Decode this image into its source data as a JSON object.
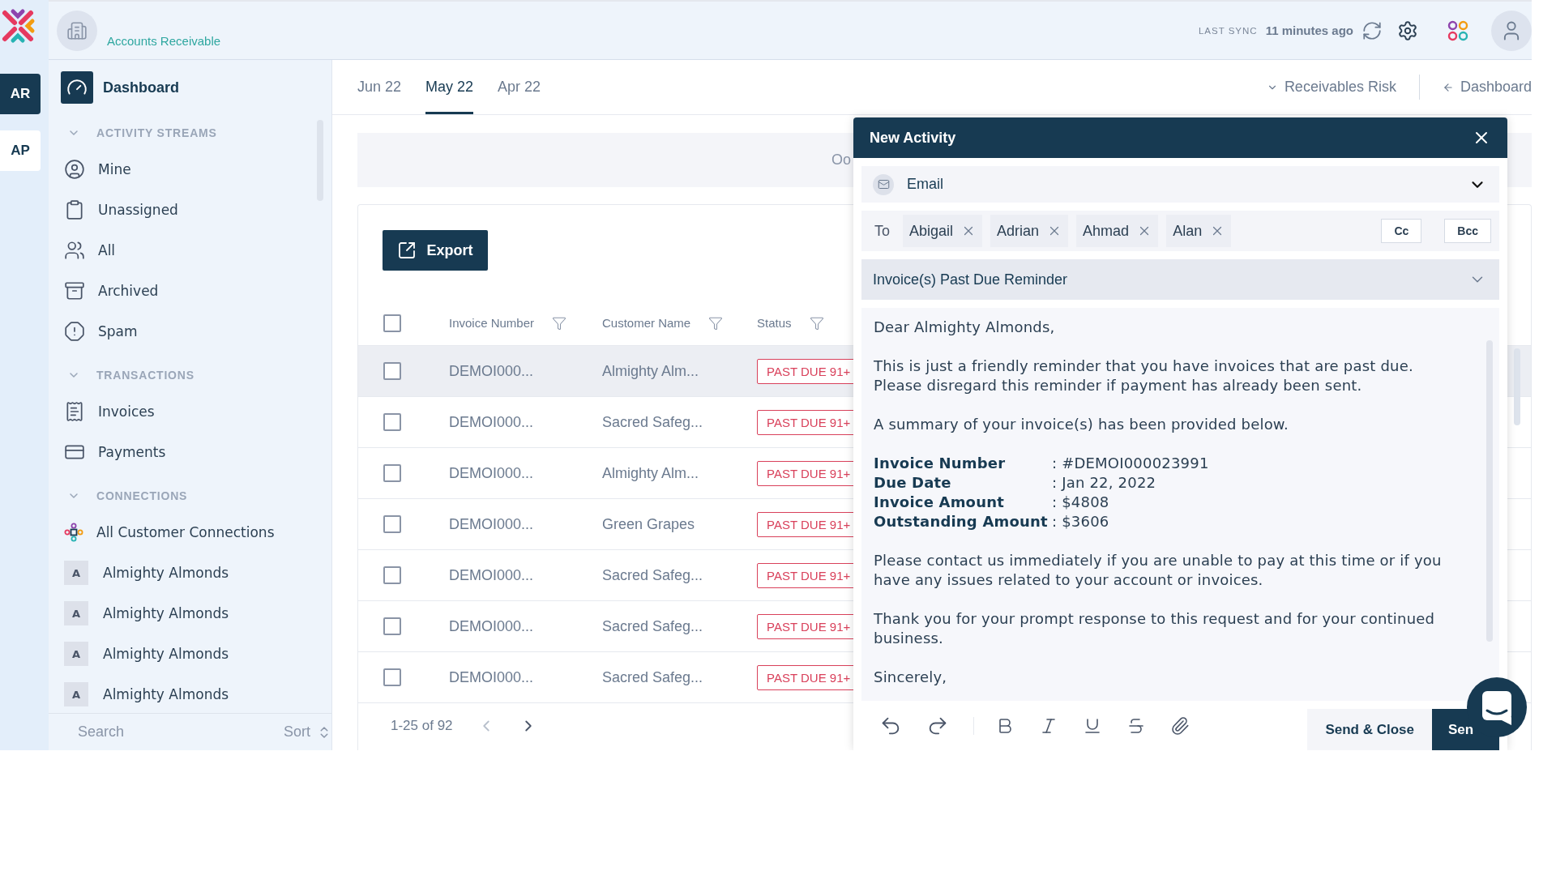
{
  "rail": {
    "items": [
      {
        "label": "AR",
        "selected": true
      },
      {
        "label": "AP",
        "selected": false
      }
    ]
  },
  "header": {
    "module": "Accounts Receivable",
    "sync_label": "LAST SYNC",
    "sync_time": "11 minutes ago"
  },
  "sidebar": {
    "dashboard": {
      "label": "Dashboard",
      "selected": true
    },
    "sections": [
      {
        "title": "ACTIVITY STREAMS",
        "expanded": true,
        "items": [
          {
            "label": "Mine",
            "kind": "user"
          },
          {
            "label": "Unassigned",
            "kind": "clipboard"
          },
          {
            "label": "All",
            "kind": "people"
          },
          {
            "label": "Archived",
            "kind": "archive"
          },
          {
            "label": "Spam",
            "kind": "alert"
          }
        ]
      },
      {
        "title": "TRANSACTIONS",
        "expanded": true,
        "items": [
          {
            "label": "Invoices",
            "kind": "invoice"
          },
          {
            "label": "Payments",
            "kind": "payment"
          }
        ]
      },
      {
        "title": "CONNECTIONS",
        "expanded": true,
        "items": [
          {
            "label": "All Customer Connections",
            "kind": "connections"
          },
          {
            "label": "Almighty Almonds",
            "kind": "letter",
            "letter": "A"
          },
          {
            "label": "Almighty Almonds",
            "kind": "letter",
            "letter": "A"
          },
          {
            "label": "Almighty Almonds",
            "kind": "letter",
            "letter": "A"
          },
          {
            "label": "Almighty Almonds",
            "kind": "letter",
            "letter": "A"
          }
        ]
      }
    ],
    "search": {
      "placeholder": "Search"
    },
    "sort": "Sort"
  },
  "tabs": [
    {
      "label": "Jun 22",
      "selected": false
    },
    {
      "label": "May 22",
      "selected": true
    },
    {
      "label": "Apr 22",
      "selected": false
    }
  ],
  "links": {
    "risk": "Receivables Risk",
    "back": "Dashboard"
  },
  "banner": "Oo",
  "table": {
    "export": "Export",
    "all_checked": false,
    "columns": [
      "Invoice Number",
      "Customer Name",
      "Status"
    ],
    "rows": [
      {
        "invoice": "DEMOI000...",
        "customer": "Almighty Alm...",
        "status": "PAST DUE 91+",
        "checked": false,
        "selected": true
      },
      {
        "invoice": "DEMOI000...",
        "customer": "Sacred Safeg...",
        "status": "PAST DUE 91+",
        "checked": false,
        "selected": false
      },
      {
        "invoice": "DEMOI000...",
        "customer": "Almighty Alm...",
        "status": "PAST DUE 91+",
        "checked": false,
        "selected": false
      },
      {
        "invoice": "DEMOI000...",
        "customer": "Green Grapes",
        "status": "PAST DUE 91+",
        "checked": false,
        "selected": false
      },
      {
        "invoice": "DEMOI000...",
        "customer": "Sacred Safeg...",
        "status": "PAST DUE 91+",
        "checked": false,
        "selected": false
      },
      {
        "invoice": "DEMOI000...",
        "customer": "Sacred Safeg...",
        "status": "PAST DUE 91+",
        "checked": false,
        "selected": false
      },
      {
        "invoice": "DEMOI000...",
        "customer": "Sacred Safeg...",
        "status": "PAST DUE 91+",
        "checked": false,
        "selected": false
      }
    ],
    "pagination": "1-25 of 92"
  },
  "modal": {
    "title": "New Activity",
    "channel": "Email",
    "to_label": "To",
    "recipients": [
      "Abigail",
      "Adrian",
      "Ahmad",
      "Alan"
    ],
    "cc": "Cc",
    "bcc": "Bcc",
    "template": "Invoice(s) Past Due Reminder",
    "body": [
      {
        "kind": "text",
        "lines": [
          "Dear Almighty Almonds,"
        ]
      },
      {
        "kind": "text",
        "lines": [
          "This is just a friendly reminder that you have invoices that are past due.",
          "Please disregard this reminder if payment has already been sent."
        ]
      },
      {
        "kind": "text",
        "lines": [
          "A summary of your invoice(s) has been provided below."
        ]
      },
      {
        "kind": "summary",
        "rows": [
          {
            "label": "Invoice Number",
            "value": ": #DEMOI000023991"
          },
          {
            "label": "Due Date",
            "value": ": Jan 22, 2022"
          },
          {
            "label": "Invoice Amount",
            "value": ": $4808"
          },
          {
            "label": "Outstanding Amount",
            "value": ": $3606"
          }
        ]
      },
      {
        "kind": "text",
        "lines": [
          "Please contact us immediately if you are unable to pay at this time or if you have any issues related to your account or invoices."
        ]
      },
      {
        "kind": "text",
        "lines": [
          "Thank you for your prompt response to this request and for your continued business."
        ]
      },
      {
        "kind": "text",
        "lines": [
          "Sincerely,"
        ]
      }
    ],
    "send_close": "Send & Close",
    "send": "Sen"
  }
}
